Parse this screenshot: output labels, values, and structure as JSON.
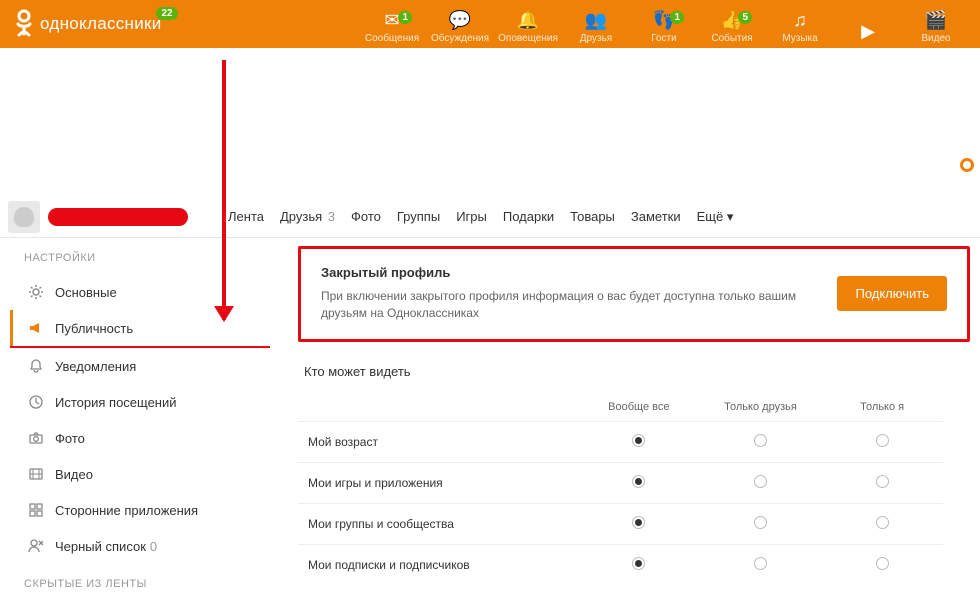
{
  "header": {
    "site_name": "одноклассники",
    "logo_badge": "22",
    "nav": [
      {
        "icon": "✉",
        "label": "Сообщения",
        "badge": "1"
      },
      {
        "icon": "💬",
        "label": "Обсуждения",
        "badge": null
      },
      {
        "icon": "🔔",
        "label": "Оповещения",
        "badge": null
      },
      {
        "icon": "👥",
        "label": "Друзья",
        "badge": null
      },
      {
        "icon": "👣",
        "label": "Гости",
        "badge": "1"
      },
      {
        "icon": "👍",
        "label": "События",
        "badge": "5"
      },
      {
        "icon": "♫",
        "label": "Музыка",
        "badge": null
      },
      {
        "icon": "▶",
        "label": "",
        "badge": null
      },
      {
        "icon": "🎬",
        "label": "Видео",
        "badge": null
      }
    ]
  },
  "section_tabs": [
    {
      "label": "Лента",
      "count": null
    },
    {
      "label": "Друзья",
      "count": "3"
    },
    {
      "label": "Фото",
      "count": null
    },
    {
      "label": "Группы",
      "count": null
    },
    {
      "label": "Игры",
      "count": null
    },
    {
      "label": "Подарки",
      "count": null
    },
    {
      "label": "Товары",
      "count": null
    },
    {
      "label": "Заметки",
      "count": null
    },
    {
      "label": "Ещё ▾",
      "count": null
    }
  ],
  "sidebar": {
    "title": "НАСТРОЙКИ",
    "secondary_title": "СКРЫТЫЕ ИЗ ЛЕНТЫ",
    "items": [
      {
        "icon": "⚙",
        "label": "Основные",
        "active": false,
        "count": null
      },
      {
        "icon": "megaphone",
        "label": "Публичность",
        "active": true,
        "count": null
      },
      {
        "icon": "🔔",
        "label": "Уведомления",
        "active": false,
        "count": null
      },
      {
        "icon": "clock",
        "label": "История посещений",
        "active": false,
        "count": null
      },
      {
        "icon": "camera",
        "label": "Фото",
        "active": false,
        "count": null
      },
      {
        "icon": "film",
        "label": "Видео",
        "active": false,
        "count": null
      },
      {
        "icon": "apps",
        "label": "Сторонние приложения",
        "active": false,
        "count": null
      },
      {
        "icon": "user-x",
        "label": "Черный список",
        "active": false,
        "count": "0"
      }
    ]
  },
  "closed_profile": {
    "title": "Закрытый профиль",
    "description": "При включении закрытого профиля информация о вас будет доступна только вашим друзьям на Одноклассниках",
    "button": "Подключить"
  },
  "visibility_table": {
    "title": "Кто может видеть",
    "columns": [
      "Вообще все",
      "Только друзья",
      "Только я"
    ],
    "rows": [
      {
        "label": "Мой возраст",
        "selected": 0
      },
      {
        "label": "Мои игры и приложения",
        "selected": 0
      },
      {
        "label": "Мои группы и сообщества",
        "selected": 0
      },
      {
        "label": "Мои подписки и подписчиков",
        "selected": 0
      }
    ]
  }
}
